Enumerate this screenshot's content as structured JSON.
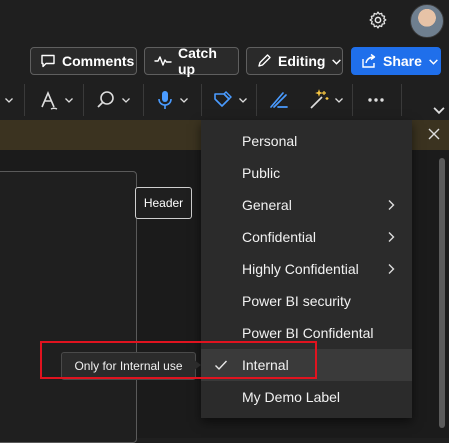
{
  "toolbar": {
    "comments_label": "Comments",
    "catchup_label": "Catch up",
    "editing_label": "Editing",
    "share_label": "Share"
  },
  "document": {
    "header_label": "Header"
  },
  "sensitivity_menu": {
    "items": [
      {
        "label": "Personal",
        "submenu": false,
        "selected": false
      },
      {
        "label": "Public",
        "submenu": false,
        "selected": false
      },
      {
        "label": "General",
        "submenu": true,
        "selected": false
      },
      {
        "label": "Confidential",
        "submenu": true,
        "selected": false
      },
      {
        "label": "Highly Confidential",
        "submenu": true,
        "selected": false
      },
      {
        "label": "Power BI security",
        "submenu": false,
        "selected": false
      },
      {
        "label": "Power BI Confidental",
        "submenu": false,
        "selected": false
      },
      {
        "label": "Internal",
        "submenu": false,
        "selected": true
      },
      {
        "label": "My Demo Label",
        "submenu": false,
        "selected": false
      }
    ],
    "selected_tooltip": "Only for Internal use"
  },
  "colors": {
    "accent": "#1f6feb",
    "highlight": "#e0131f"
  },
  "icons": [
    "settings-gear-icon",
    "comment-icon",
    "activity-icon",
    "pencil-icon",
    "share-icon",
    "font-icon",
    "search-icon",
    "microphone-icon",
    "sensitivity-icon",
    "designer-icon",
    "magic-wand-icon",
    "more-icon",
    "close-icon",
    "chevron-down-icon",
    "chevron-right-icon",
    "checkmark-icon"
  ]
}
